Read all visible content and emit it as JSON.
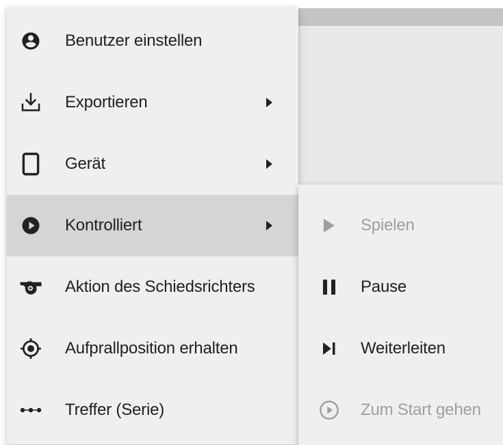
{
  "colors": {
    "menu_background": "#efefef",
    "active_item": "#d5d5d5",
    "text": "#212121",
    "disabled_text": "#9e9e9e"
  },
  "menu": {
    "items": [
      {
        "label": "Benutzer einstellen",
        "icon": "account-circle-icon",
        "has_submenu": false
      },
      {
        "label": "Exportieren",
        "icon": "download-icon",
        "has_submenu": true
      },
      {
        "label": "Gerät",
        "icon": "smartphone-icon",
        "has_submenu": true
      },
      {
        "label": "Kontrolliert",
        "icon": "play-circle-icon",
        "has_submenu": true,
        "active": true
      },
      {
        "label": "Aktion des Schiedsrichters",
        "icon": "whistle-icon",
        "has_submenu": false
      },
      {
        "label": "Aufprallposition erhalten",
        "icon": "gps-target-icon",
        "has_submenu": false
      },
      {
        "label": "Treffer (Serie)",
        "icon": "dots-series-icon",
        "has_submenu": false
      }
    ]
  },
  "submenu": {
    "items": [
      {
        "label": "Spielen",
        "icon": "play-icon",
        "disabled": true
      },
      {
        "label": "Pause",
        "icon": "pause-icon",
        "disabled": false
      },
      {
        "label": "Weiterleiten",
        "icon": "skip-next-icon",
        "disabled": false
      },
      {
        "label": "Zum Start gehen",
        "icon": "play-circle-outline-icon",
        "disabled": true
      }
    ]
  }
}
